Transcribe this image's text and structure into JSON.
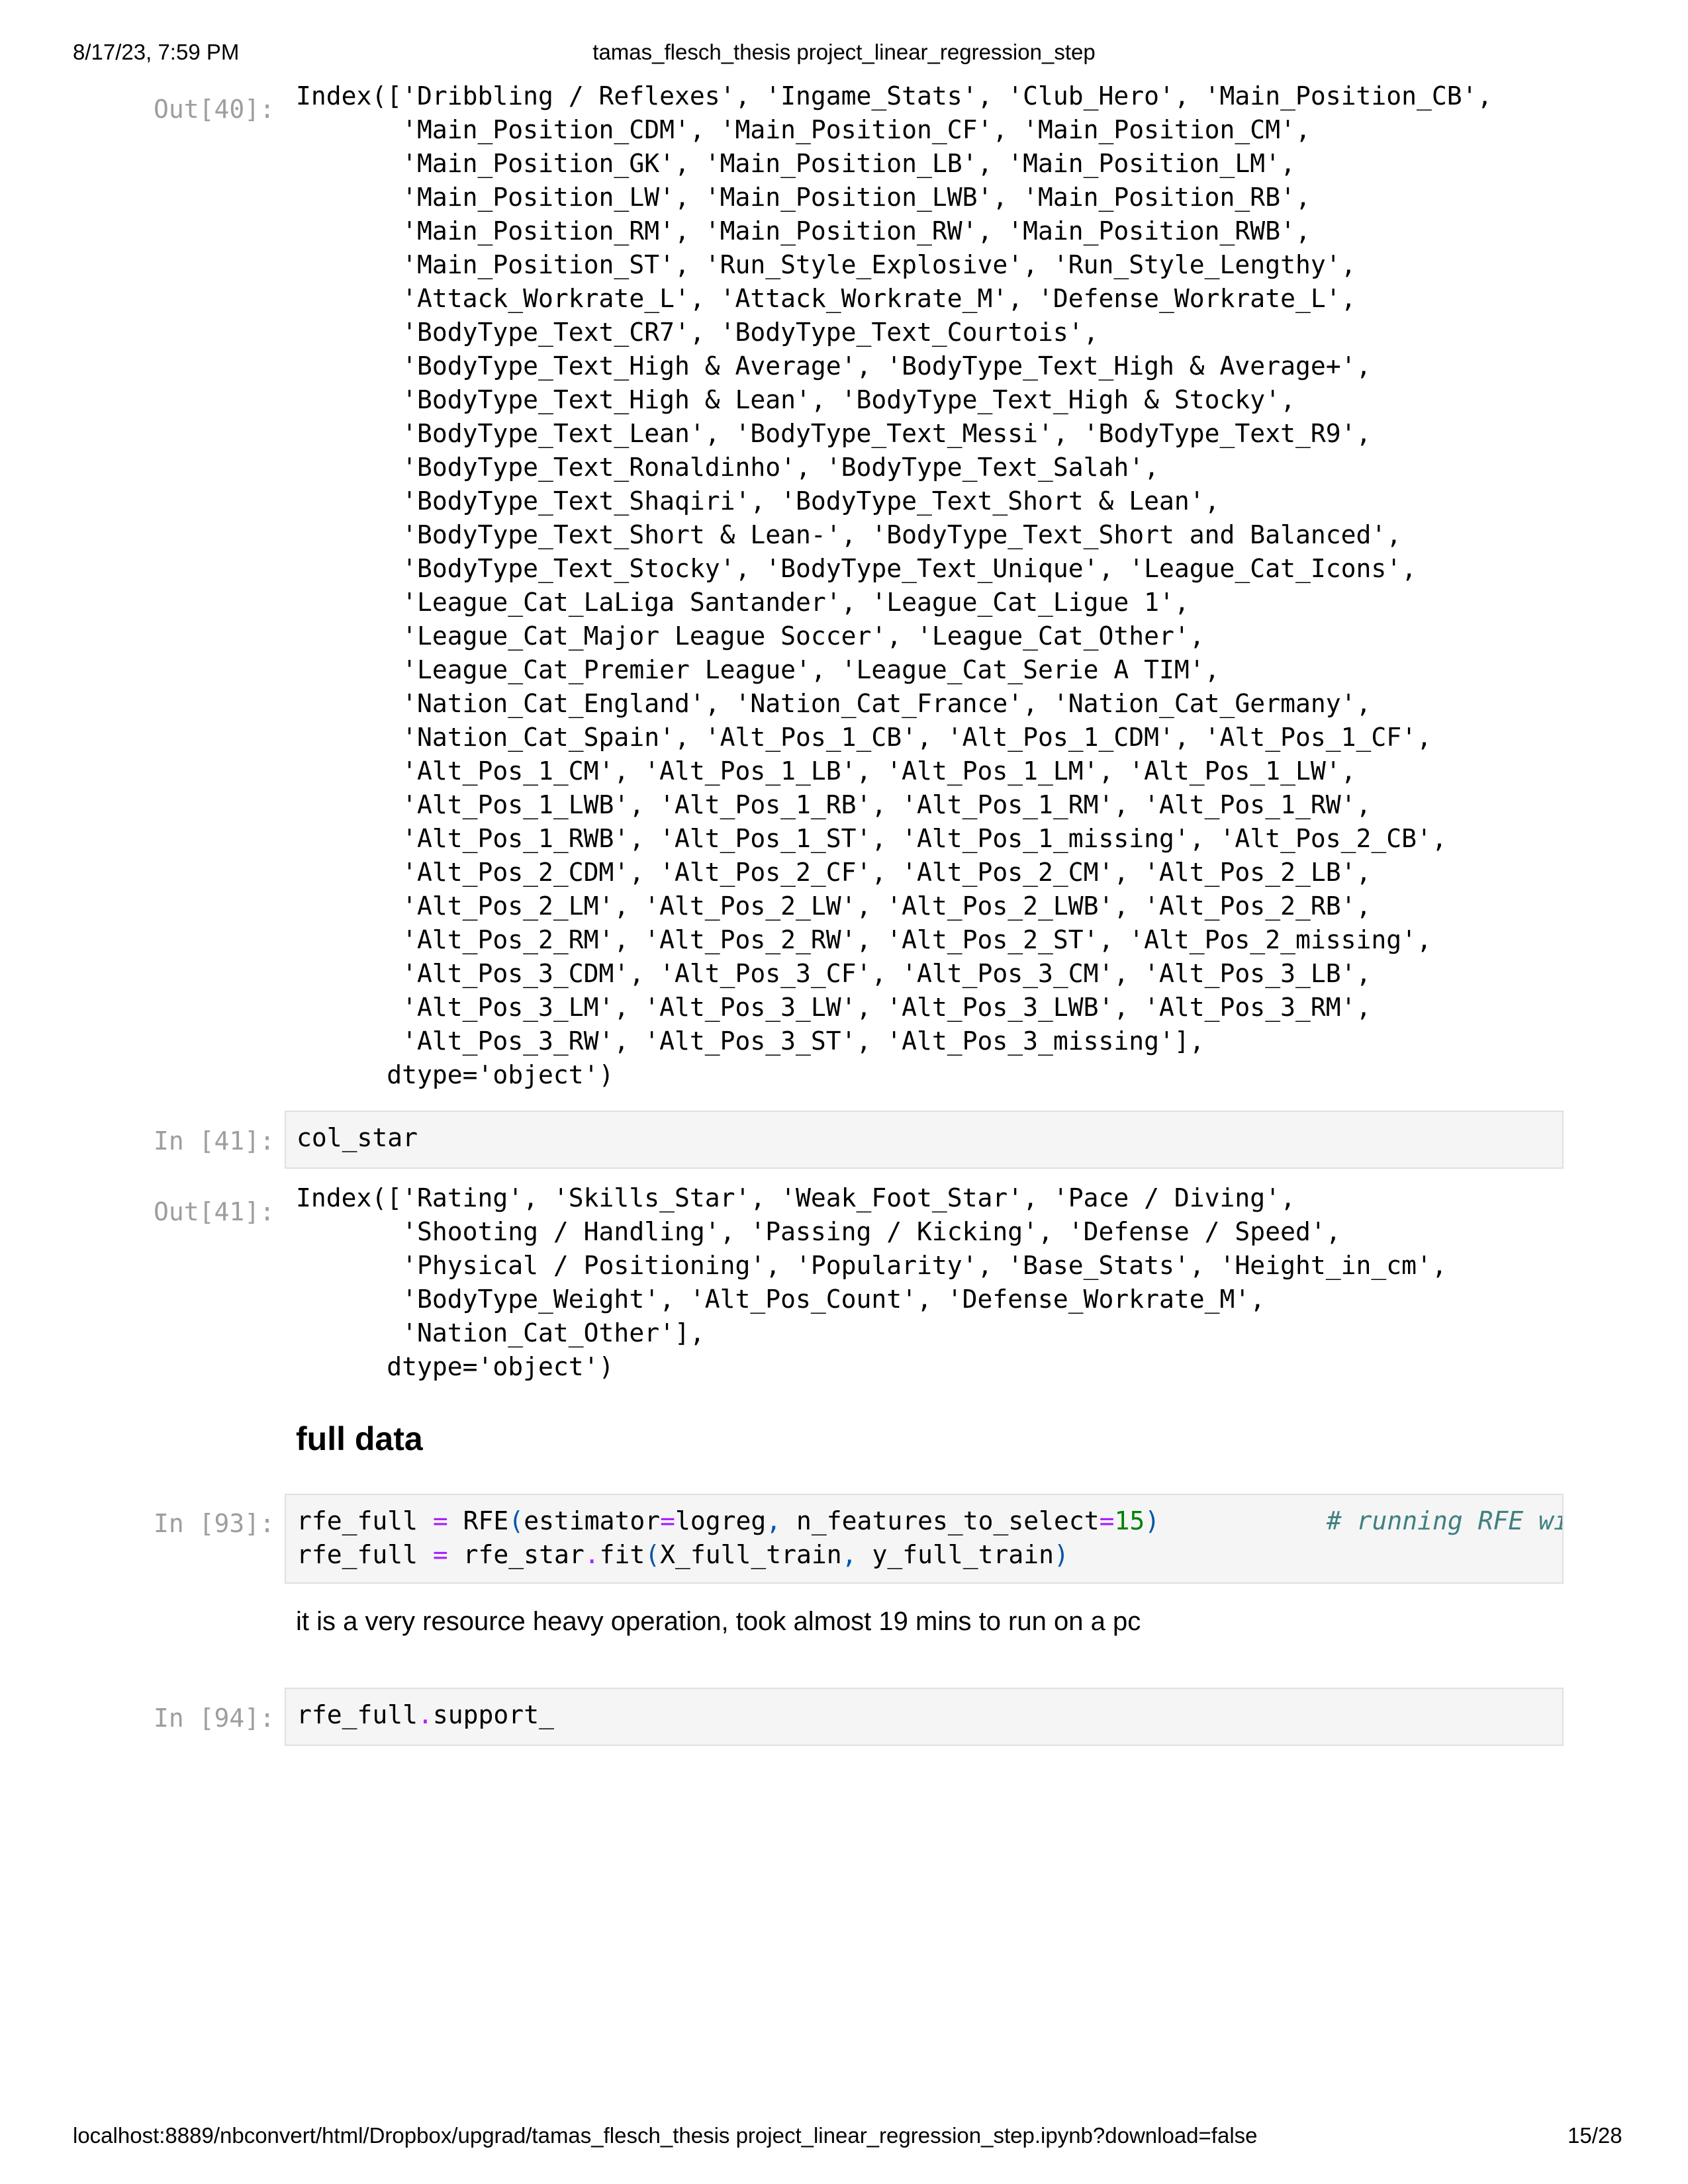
{
  "header": {
    "datetime": "8/17/23, 7:59 PM",
    "title": "tamas_flesch_thesis project_linear_regression_step"
  },
  "footer": {
    "url": "localhost:8889/nbconvert/html/Dropbox/upgrad/tamas_flesch_thesis project_linear_regression_step.ipynb?download=false",
    "page": "15/28"
  },
  "cells": {
    "out40": {
      "prompt": "Out[40]:",
      "text": "Index(['Dribbling / Reflexes', 'Ingame_Stats', 'Club_Hero', 'Main_Position_CB',\n       'Main_Position_CDM', 'Main_Position_CF', 'Main_Position_CM',\n       'Main_Position_GK', 'Main_Position_LB', 'Main_Position_LM',\n       'Main_Position_LW', 'Main_Position_LWB', 'Main_Position_RB',\n       'Main_Position_RM', 'Main_Position_RW', 'Main_Position_RWB',\n       'Main_Position_ST', 'Run_Style_Explosive', 'Run_Style_Lengthy',\n       'Attack_Workrate_L', 'Attack_Workrate_M', 'Defense_Workrate_L',\n       'BodyType_Text_CR7', 'BodyType_Text_Courtois',\n       'BodyType_Text_High & Average', 'BodyType_Text_High & Average+',\n       'BodyType_Text_High & Lean', 'BodyType_Text_High & Stocky',\n       'BodyType_Text_Lean', 'BodyType_Text_Messi', 'BodyType_Text_R9',\n       'BodyType_Text_Ronaldinho', 'BodyType_Text_Salah',\n       'BodyType_Text_Shaqiri', 'BodyType_Text_Short & Lean',\n       'BodyType_Text_Short & Lean-', 'BodyType_Text_Short and Balanced',\n       'BodyType_Text_Stocky', 'BodyType_Text_Unique', 'League_Cat_Icons',\n       'League_Cat_LaLiga Santander', 'League_Cat_Ligue 1',\n       'League_Cat_Major League Soccer', 'League_Cat_Other',\n       'League_Cat_Premier League', 'League_Cat_Serie A TIM',\n       'Nation_Cat_England', 'Nation_Cat_France', 'Nation_Cat_Germany',\n       'Nation_Cat_Spain', 'Alt_Pos_1_CB', 'Alt_Pos_1_CDM', 'Alt_Pos_1_CF',\n       'Alt_Pos_1_CM', 'Alt_Pos_1_LB', 'Alt_Pos_1_LM', 'Alt_Pos_1_LW',\n       'Alt_Pos_1_LWB', 'Alt_Pos_1_RB', 'Alt_Pos_1_RM', 'Alt_Pos_1_RW',\n       'Alt_Pos_1_RWB', 'Alt_Pos_1_ST', 'Alt_Pos_1_missing', 'Alt_Pos_2_CB',\n       'Alt_Pos_2_CDM', 'Alt_Pos_2_CF', 'Alt_Pos_2_CM', 'Alt_Pos_2_LB',\n       'Alt_Pos_2_LM', 'Alt_Pos_2_LW', 'Alt_Pos_2_LWB', 'Alt_Pos_2_RB',\n       'Alt_Pos_2_RM', 'Alt_Pos_2_RW', 'Alt_Pos_2_ST', 'Alt_Pos_2_missing',\n       'Alt_Pos_3_CDM', 'Alt_Pos_3_CF', 'Alt_Pos_3_CM', 'Alt_Pos_3_LB',\n       'Alt_Pos_3_LM', 'Alt_Pos_3_LW', 'Alt_Pos_3_LWB', 'Alt_Pos_3_RM',\n       'Alt_Pos_3_RW', 'Alt_Pos_3_ST', 'Alt_Pos_3_missing'],\n      dtype='object')"
    },
    "in41": {
      "prompt": "In [41]:",
      "code": "col_star"
    },
    "out41": {
      "prompt": "Out[41]:",
      "text": "Index(['Rating', 'Skills_Star', 'Weak_Foot_Star', 'Pace / Diving',\n       'Shooting / Handling', 'Passing / Kicking', 'Defense / Speed',\n       'Physical / Positioning', 'Popularity', 'Base_Stats', 'Height_in_cm',\n       'BodyType_Weight', 'Alt_Pos_Count', 'Defense_Workrate_M',\n       'Nation_Cat_Other'],\n      dtype='object')"
    },
    "md_heading": "full data",
    "in93": {
      "prompt": "In [93]:",
      "line1": {
        "a": "rfe_full ",
        "eq1": "=",
        "b": " RFE",
        "p1": "(",
        "c": "estimator",
        "eq2": "=",
        "d": "logreg",
        "comma": ",",
        "e": " n_features_to_select",
        "eq3": "=",
        "num": "15",
        "p2": ")",
        "comment": "# running RFE wi"
      },
      "line2": {
        "a": "rfe_full ",
        "eq": "=",
        "b": " rfe_star",
        "dot": ".",
        "c": "fit",
        "p1": "(",
        "d": "X_full_train",
        "comma": ",",
        "e": " y_full_train",
        "p2": ")"
      }
    },
    "md_text": "it is a very resource heavy operation, took almost 19 mins to run on a pc",
    "in94": {
      "prompt": "In [94]:",
      "a": "rfe_full",
      "dot": ".",
      "b": "support_"
    }
  }
}
